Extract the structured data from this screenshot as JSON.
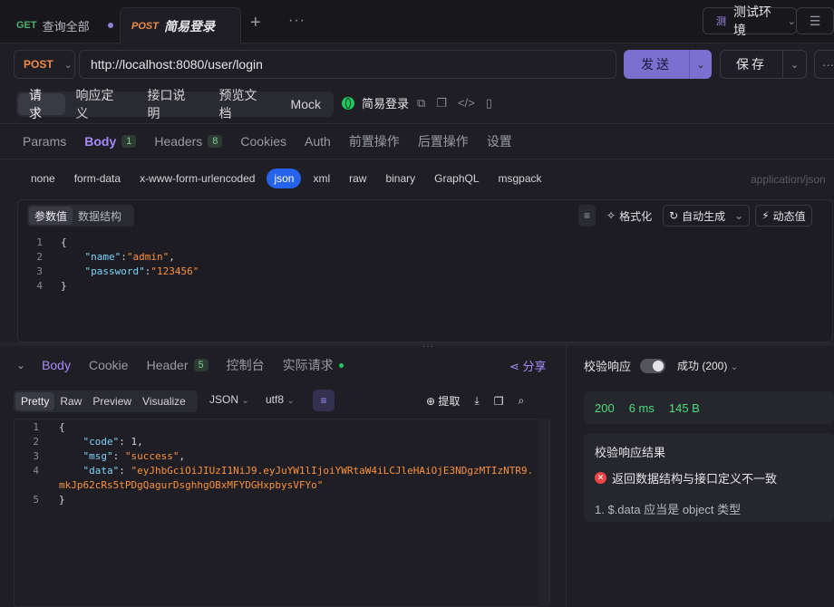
{
  "tabs": [
    {
      "method": "GET",
      "label": "查询全部"
    },
    {
      "method": "POST",
      "label": "简易登录"
    }
  ],
  "env": {
    "badge": "测",
    "label": "测试环境"
  },
  "request": {
    "method": "POST",
    "url": "http://localhost:8080/user/login",
    "send_label": "发送",
    "save_label": "保存"
  },
  "modes": [
    "请求",
    "响应定义",
    "接口说明",
    "预览文档",
    "Mock"
  ],
  "api_name": "简易登录",
  "subtabs": [
    {
      "label": "Params"
    },
    {
      "label": "Body",
      "count": "1"
    },
    {
      "label": "Headers",
      "count": "8"
    },
    {
      "label": "Cookies"
    },
    {
      "label": "Auth"
    },
    {
      "label": "前置操作"
    },
    {
      "label": "后置操作"
    },
    {
      "label": "设置"
    }
  ],
  "body_types": [
    "none",
    "form-data",
    "x-www-form-urlencoded",
    "json",
    "xml",
    "raw",
    "binary",
    "GraphQL",
    "msgpack"
  ],
  "content_type": "application/json",
  "editor": {
    "tabs": [
      "参数值",
      "数据结构"
    ],
    "tools": {
      "format": "格式化",
      "auto": "自动生成",
      "dynamic": "动态值"
    },
    "lines": [
      "1",
      "2",
      "3",
      "4"
    ],
    "body": {
      "name": "admin",
      "password": "123456"
    }
  },
  "response": {
    "tabs": [
      {
        "label": "Body"
      },
      {
        "label": "Cookie"
      },
      {
        "label": "Header",
        "count": "5"
      },
      {
        "label": "控制台"
      },
      {
        "label": "实际请求"
      }
    ],
    "share": "分享",
    "views": [
      "Pretty",
      "Raw",
      "Preview",
      "Visualize"
    ],
    "format": "JSON",
    "encoding": "utf8",
    "extract": "提取",
    "lines": [
      "1",
      "2",
      "3",
      "4",
      "5"
    ],
    "body": {
      "code": "1",
      "msg": "success",
      "data_line1": "eyJhbGciOiJIUzI1NiJ9.eyJuYW1lIjoiYWRtaW4iLCJleHAiOjE3NDgzMTIzNTR9.",
      "data_line2": "mkJp62cRs5tPDgQagurDsghhgOBxMFYDGHxpbysVFYo"
    }
  },
  "validation": {
    "title": "校验响应",
    "status": "成功 (200)",
    "code": "200",
    "time": "6 ms",
    "size": "145 B",
    "result_title": "校验响应结果",
    "error": "返回数据结构与接口定义不一致",
    "detail": "1. $.data 应当是 object 类型"
  }
}
